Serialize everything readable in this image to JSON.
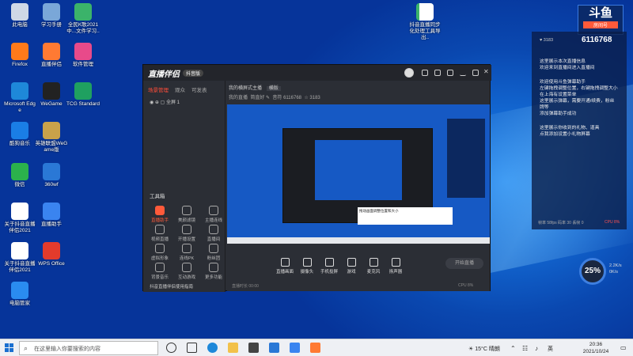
{
  "desktop": {
    "icons": [
      {
        "label": "此电脑",
        "color": "#cfd8e6"
      },
      {
        "label": "学习手册",
        "color": "#7aa7d8"
      },
      {
        "label": "全民K歌2021中...文件学习..",
        "color": "#3bb36a"
      },
      {
        "label": "Firefox",
        "color": "#ff7a1a"
      },
      {
        "label": "直播伴侣",
        "color": "#ff7a33"
      },
      {
        "label": "软件管理",
        "color": "#e84a8a"
      },
      {
        "label": "Microsoft Edge",
        "color": "#1e88d9"
      },
      {
        "label": "WeGame",
        "color": "#222222"
      },
      {
        "label": "TCG Standard",
        "color": "#1fa060"
      },
      {
        "label": "酷狗音乐",
        "color": "#1a7ee6"
      },
      {
        "label": "英雄联盟WeGame版",
        "color": "#c9a24a"
      },
      {
        "label": "微信",
        "color": "#2bb24c"
      },
      {
        "label": "360wf",
        "color": "#2a78d6"
      },
      {
        "label": "关于抖音直播伴侣2021",
        "color": "#ffffff"
      },
      {
        "label": "直播助手",
        "color": "#3a84f0"
      },
      {
        "label": "关于抖音直播伴侣2021",
        "color": "#ffffff"
      },
      {
        "label": "WPS Office",
        "color": "#e33b2c"
      },
      {
        "label": "电脑管家",
        "color": "#2a8cf0"
      }
    ],
    "doc_icon": {
      "label": "抖音直播同步化处理工具导出..",
      "color": "#3bb36a"
    }
  },
  "window": {
    "app_title": "直播伴侣",
    "version_badge": "抖音版",
    "tabs": [
      "场景管理",
      "观众",
      "可发表"
    ],
    "scene_item": "全屏 1",
    "stage_title": "我的横屏式主播",
    "stage_tag": "横版",
    "stage_meta": [
      "我的直播",
      "简直好 ✎",
      "音符 6116768",
      "☆ 3183"
    ],
    "tools_title": "工具箱",
    "tools": [
      {
        "label": "直播助手",
        "active": true
      },
      {
        "label": "美颜滤镜",
        "active": false
      },
      {
        "label": "主播连线",
        "active": false
      },
      {
        "label": "视频直播",
        "active": false
      },
      {
        "label": "开播设置",
        "active": false
      },
      {
        "label": "直播间",
        "active": false
      },
      {
        "label": "虚拟形象",
        "active": false
      },
      {
        "label": "连线PK",
        "active": false
      },
      {
        "label": "粉丝团",
        "active": false
      },
      {
        "label": "背景音乐",
        "active": false
      },
      {
        "label": "互动游戏",
        "active": false
      },
      {
        "label": "更多功能",
        "active": false
      }
    ],
    "footer_note": "抖音直播伴侣使用指南",
    "controls": [
      {
        "label": "直播画面"
      },
      {
        "label": "摄像头"
      },
      {
        "label": "手机投屏"
      },
      {
        "label": "游戏"
      },
      {
        "label": "麦克风"
      },
      {
        "label": "扬声器"
      }
    ],
    "start_button": "开始直播",
    "status_left": "直播时长 00:00",
    "status_right": "CPU 8%"
  },
  "overlay": {
    "brand": "斗鱼",
    "brand_sub": "房间号",
    "room_number": "6116768",
    "fans_label": "♥ 3183",
    "chat": [
      {
        "text": "这里展示本次直播信息",
        "red": false
      },
      {
        "text": "欢迎来到直播间进入直播间",
        "red": false
      },
      {
        "text": "欢迎使用斗鱼弹幕助手",
        "red": false
      },
      {
        "text": "左键拖拽调整位置，右键拖拽调整大小",
        "red": false
      },
      {
        "text": "在上海有设置菜单",
        "red": false
      },
      {
        "text": "这里展示弹幕，需要开通/续费，粉丝牌等",
        "red": false
      },
      {
        "text": "添加弹幕助手成功",
        "red": false
      },
      {
        "text": "这里展示你收到的礼物、道具",
        "red": false
      },
      {
        "text": "点我添加设置小礼物屏幕",
        "red": false
      }
    ],
    "perf_left": "帧率 58fps  码率 30  丢帧 0",
    "perf_right": "CPU 8%",
    "gauge_value": "25%",
    "net_up": "2.2K/s",
    "net_down": "0K/s"
  },
  "taskbar": {
    "search_placeholder": "在这里输入你要搜索的内容",
    "weather": "15°C 晴朗",
    "ime": "英",
    "time": "20:36",
    "date": "2021/10/24"
  },
  "colors": {
    "accent": "#ff4d3a",
    "desktop": "#1266d0",
    "chat_bg": "#0a1c46"
  }
}
